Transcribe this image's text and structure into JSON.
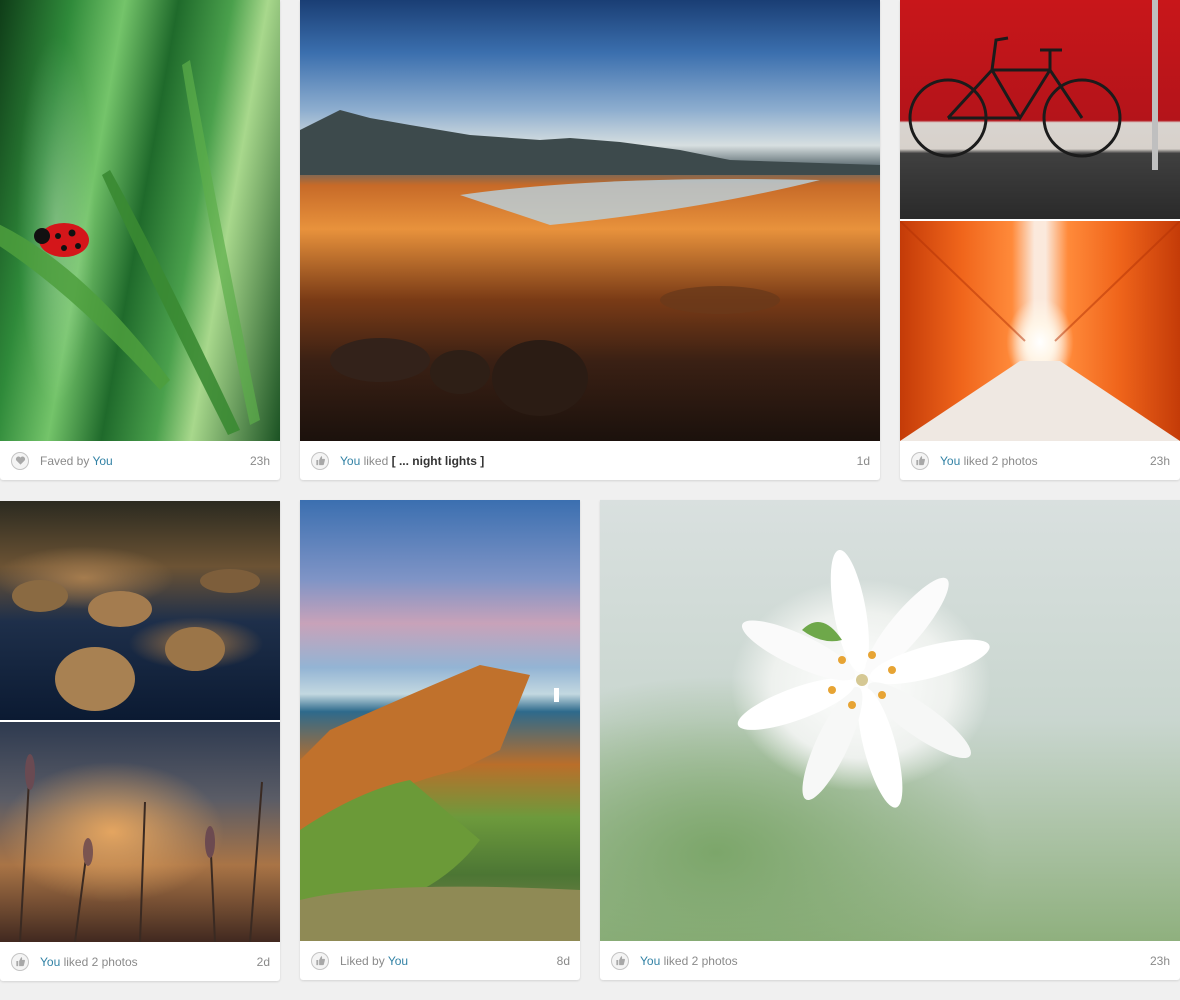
{
  "colors": {
    "link": "#3282a5",
    "muted": "#8a8a8a",
    "bold_text": "#333333",
    "page_bg": "#f0f0f0"
  },
  "cards": [
    {
      "photos": [
        {
          "subject": "ladybug-on-grass"
        }
      ],
      "activity": {
        "icon": "heart-icon",
        "prefix": "Faved by ",
        "you": "You",
        "mid": "",
        "set": "",
        "suffix": ""
      },
      "time": "23h"
    },
    {
      "photos": [
        {
          "subject": "rocky-coast-landscape"
        }
      ],
      "activity": {
        "icon": "thumbs-up-icon",
        "prefix": "",
        "you": "You",
        "mid": " liked ",
        "set": "[ ... night lights ]",
        "suffix": ""
      },
      "time": "1d"
    },
    {
      "photos": [
        {
          "subject": "bicycle-red-wall"
        },
        {
          "subject": "orange-tunnel"
        }
      ],
      "activity": {
        "icon": "thumbs-up-icon",
        "prefix": "",
        "you": "You",
        "mid": " liked 2 photos",
        "set": "",
        "suffix": ""
      },
      "time": "23h"
    },
    {
      "photos": [
        {
          "subject": "marsh-grass-tufts"
        },
        {
          "subject": "wildflowers-bokeh"
        }
      ],
      "activity": {
        "icon": "thumbs-up-icon",
        "prefix": "",
        "you": "You",
        "mid": " liked 2 photos",
        "set": "",
        "suffix": ""
      },
      "time": "2d"
    },
    {
      "photos": [
        {
          "subject": "coastal-cliffs-lighthouse"
        }
      ],
      "activity": {
        "icon": "thumbs-up-icon",
        "prefix": "Liked by ",
        "you": "You",
        "mid": "",
        "set": "",
        "suffix": ""
      },
      "time": "8d"
    },
    {
      "photos": [
        {
          "subject": "white-lily-flower"
        }
      ],
      "activity": {
        "icon": "thumbs-up-icon",
        "prefix": "",
        "you": "You",
        "mid": " liked 2 photos",
        "set": "",
        "suffix": ""
      },
      "time": "23h"
    }
  ]
}
